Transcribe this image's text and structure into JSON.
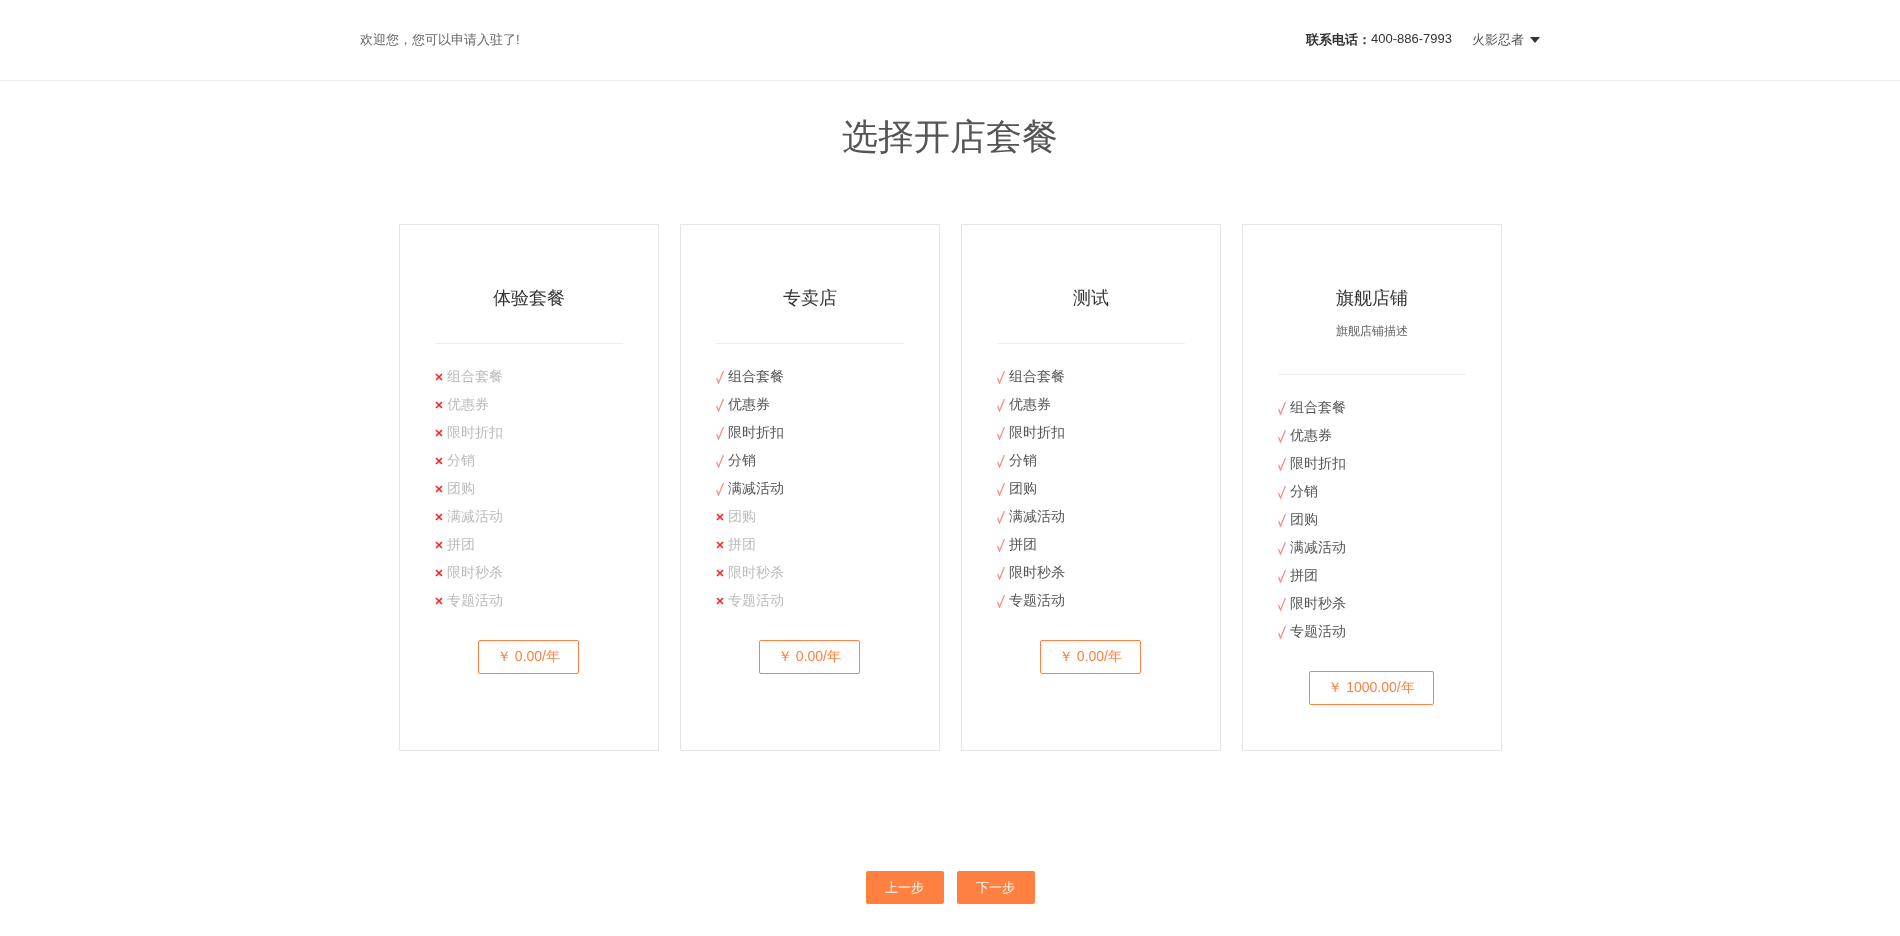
{
  "header": {
    "welcome": "欢迎您，您可以申请入驻了!",
    "phone_label": "联系电话：",
    "phone": "400-886-7993",
    "user": "火影忍者"
  },
  "title": "选择开店套餐",
  "plans": [
    {
      "name": "体验套餐",
      "price": "￥ 0.00/年",
      "features": [
        {
          "label": "组合套餐",
          "included": false
        },
        {
          "label": "优惠券",
          "included": false
        },
        {
          "label": "限时折扣",
          "included": false
        },
        {
          "label": "分销",
          "included": false
        },
        {
          "label": "团购",
          "included": false
        },
        {
          "label": "满减活动",
          "included": false
        },
        {
          "label": "拼团",
          "included": false
        },
        {
          "label": "限时秒杀",
          "included": false
        },
        {
          "label": "专题活动",
          "included": false
        }
      ]
    },
    {
      "name": "专卖店",
      "price": "￥ 0.00/年",
      "features": [
        {
          "label": "组合套餐",
          "included": true
        },
        {
          "label": "优惠券",
          "included": true
        },
        {
          "label": "限时折扣",
          "included": true
        },
        {
          "label": "分销",
          "included": true
        },
        {
          "label": "满减活动",
          "included": true
        },
        {
          "label": "团购",
          "included": false
        },
        {
          "label": "拼团",
          "included": false
        },
        {
          "label": "限时秒杀",
          "included": false
        },
        {
          "label": "专题活动",
          "included": false
        }
      ]
    },
    {
      "name": "测试",
      "price": "￥ 0.00/年",
      "features": [
        {
          "label": "组合套餐",
          "included": true
        },
        {
          "label": "优惠券",
          "included": true
        },
        {
          "label": "限时折扣",
          "included": true
        },
        {
          "label": "分销",
          "included": true
        },
        {
          "label": "团购",
          "included": true
        },
        {
          "label": "满减活动",
          "included": true
        },
        {
          "label": "拼团",
          "included": true
        },
        {
          "label": "限时秒杀",
          "included": true
        },
        {
          "label": "专题活动",
          "included": true
        }
      ]
    },
    {
      "name": "旗舰店铺",
      "description": "旗舰店铺描述",
      "price": "￥ 1000.00/年",
      "features": [
        {
          "label": "组合套餐",
          "included": true
        },
        {
          "label": "优惠券",
          "included": true
        },
        {
          "label": "限时折扣",
          "included": true
        },
        {
          "label": "分销",
          "included": true
        },
        {
          "label": "团购",
          "included": true
        },
        {
          "label": "满减活动",
          "included": true
        },
        {
          "label": "拼团",
          "included": true
        },
        {
          "label": "限时秒杀",
          "included": true
        },
        {
          "label": "专题活动",
          "included": true
        }
      ]
    }
  ],
  "buttons": [
    "上一步",
    "下一步"
  ]
}
